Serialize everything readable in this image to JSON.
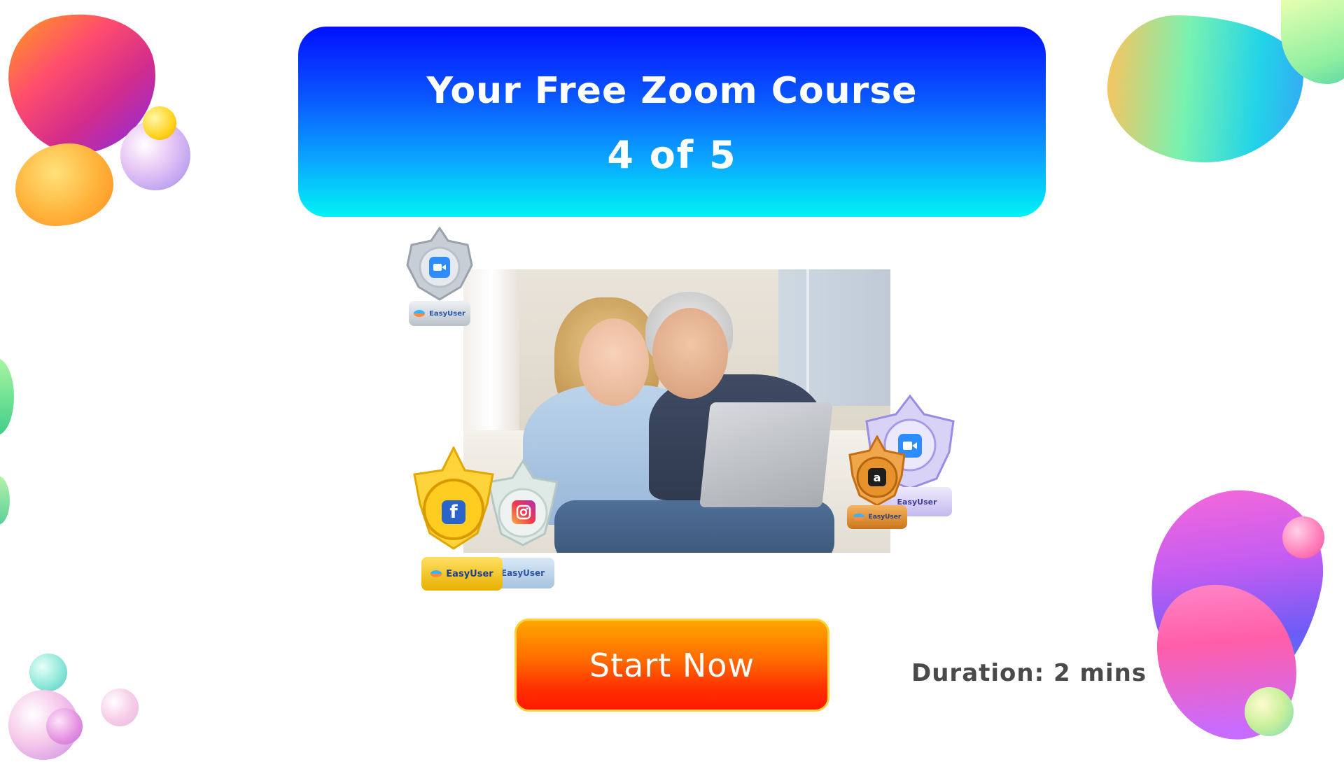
{
  "header": {
    "title": "Your Free Zoom Course",
    "progress": "4 of 5"
  },
  "hero": {
    "description_icon": "photo-couple-laptop"
  },
  "badges": {
    "zoom_silver": {
      "icon": "zoom-camera-icon",
      "ribbon": "EasyUser"
    },
    "facebook_gold": {
      "icon": "facebook-f-icon",
      "glyph": "f",
      "ribbon": "EasyUser"
    },
    "instagram_silver": {
      "icon": "instagram-icon",
      "ribbon": "EasyUser"
    },
    "amazon_bronze": {
      "icon": "amazon-icon",
      "glyph": "a",
      "ribbon": "EasyUser"
    },
    "zoom_purple": {
      "icon": "zoom-camera-icon",
      "ribbon": "EasyUser"
    }
  },
  "cta": {
    "start_label": "Start Now",
    "duration": "Duration: 2 mins"
  },
  "colors": {
    "header_top": "#0010ff",
    "header_bottom": "#00f3f5",
    "button_top": "#ffa700",
    "button_bottom": "#ff1a00",
    "duration_text": "#4a4a4a"
  }
}
